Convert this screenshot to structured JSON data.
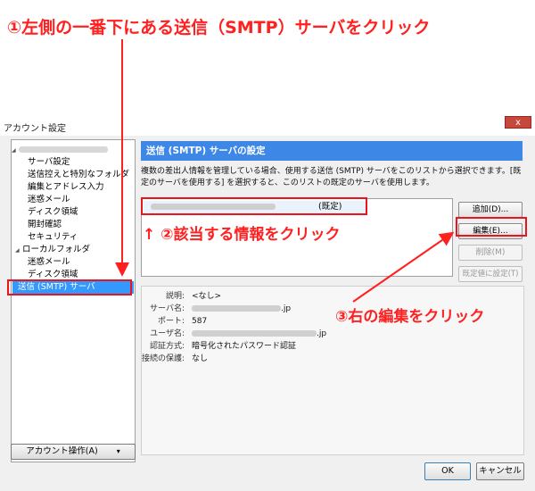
{
  "annotations": {
    "step1": "①左側の一番下にある送信（SMTP）サーバをクリック",
    "step2": "↑ ②該当する情報をクリック",
    "step3": "③右の編集をクリック"
  },
  "window": {
    "title": "アカウント設定",
    "close_label": "x"
  },
  "tree": {
    "items": [
      {
        "label": "サーバ設定"
      },
      {
        "label": "送信控えと特別なフォルダ"
      },
      {
        "label": "編集とアドレス入力"
      },
      {
        "label": "迷惑メール"
      },
      {
        "label": "ディスク領域"
      },
      {
        "label": "開封確認"
      },
      {
        "label": "セキュリティ"
      },
      {
        "label": "ローカルフォルダ"
      },
      {
        "label": "迷惑メール"
      },
      {
        "label": "ディスク領域"
      },
      {
        "label": "送信 (SMTP) サーバ"
      }
    ]
  },
  "account_actions_label": "アカウント操作(A)",
  "account_actions_arrow": "▾",
  "panel": {
    "header": "送信 (SMTP) サーバの設定",
    "description": "複数の差出人情報を管理している場合、使用する送信 (SMTP) サーバをこのリストから選択できます。[既定のサーバを使用する] を選択すると、このリストの既定のサーバを使用します。",
    "list_item_suffix": "(既定)",
    "buttons": {
      "add": "追加(D)...",
      "edit": "編集(E)...",
      "delete": "削除(M)",
      "set_default": "既定値に設定(T)"
    }
  },
  "details": {
    "rows": [
      {
        "label": "説明:",
        "value": "<なし>"
      },
      {
        "label": "サーバ名:",
        "value": ".jp"
      },
      {
        "label": "ポート:",
        "value": "587"
      },
      {
        "label": "ユーザ名:",
        "value": ".jp"
      },
      {
        "label": "認証方式:",
        "value": "暗号化されたパスワード認証"
      },
      {
        "label": "接続の保護:",
        "value": "なし"
      }
    ]
  },
  "footer": {
    "ok": "OK",
    "cancel": "キャンセル"
  },
  "colors": {
    "annotation": "#ff2020",
    "header_bg": "#3d87e6",
    "selection": "#3399ff"
  }
}
